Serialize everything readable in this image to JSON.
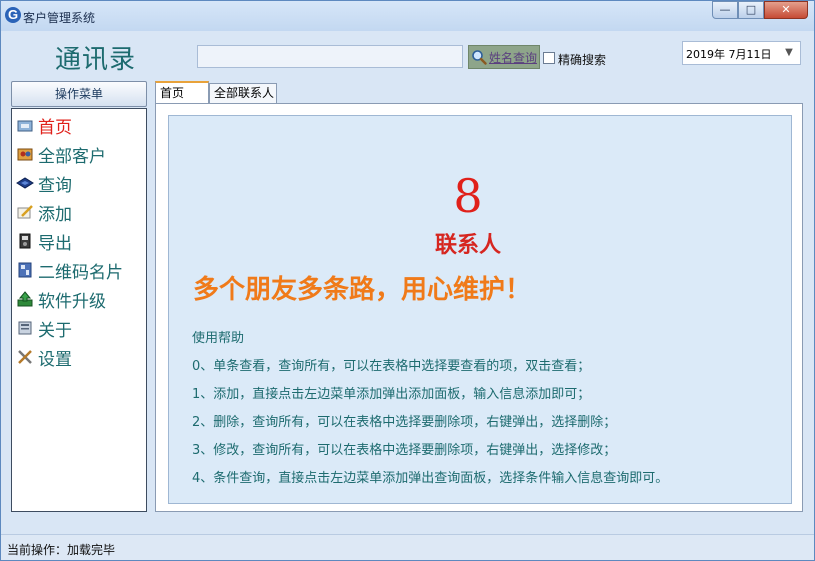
{
  "window": {
    "title": "客户管理系统",
    "buttons": {
      "minimize": "—",
      "maximize": "□",
      "close": "✕"
    }
  },
  "header": {
    "app_heading": "通讯录",
    "search": {
      "value": "",
      "placeholder": "",
      "button_label": "姓名查询"
    },
    "exact_search": {
      "label": "精确搜索",
      "checked": false
    },
    "date": "2019年 7月11日"
  },
  "sidebar": {
    "title": "操作菜单",
    "items": [
      {
        "label": "首页",
        "icon": "home-icon",
        "active": true
      },
      {
        "label": "全部客户",
        "icon": "customers-icon",
        "active": false
      },
      {
        "label": "查询",
        "icon": "query-icon",
        "active": false
      },
      {
        "label": "添加",
        "icon": "add-icon",
        "active": false
      },
      {
        "label": "导出",
        "icon": "export-icon",
        "active": false
      },
      {
        "label": "二维码名片",
        "icon": "qrcode-card-icon",
        "active": false
      },
      {
        "label": "软件升级",
        "icon": "upgrade-icon",
        "active": false
      },
      {
        "label": "关于",
        "icon": "about-icon",
        "active": false
      },
      {
        "label": "设置",
        "icon": "settings-icon",
        "active": false
      }
    ]
  },
  "tabs": [
    {
      "label": "首页",
      "active": true
    },
    {
      "label": "全部联系人",
      "active": false
    }
  ],
  "home": {
    "contact_count": "8",
    "contact_label": "联系人",
    "slogan": "多个朋友多条路，用心维护！",
    "help_title": "使用帮助",
    "help_lines": [
      "0、单条查看，查询所有，可以在表格中选择要查看的项，双击查看；",
      "1、添加，直接点击左边菜单添加弹出添加面板，输入信息添加即可；",
      "2、删除，查询所有，可以在表格中选择要删除项，右键弹出，选择删除；",
      "3、修改，查询所有，可以在表格中选择要删除项，右键弹出，选择修改；",
      "4、条件查询，直接点击左边菜单添加弹出查询面板，选择条件输入信息查询即可。"
    ]
  },
  "status": {
    "text": "当前操作：加载完毕"
  },
  "colors": {
    "accent_teal": "#1d6b6f",
    "highlight_red": "#e0201a",
    "slogan_orange": "#f07a19",
    "panel_blue": "#dbeaf8"
  }
}
